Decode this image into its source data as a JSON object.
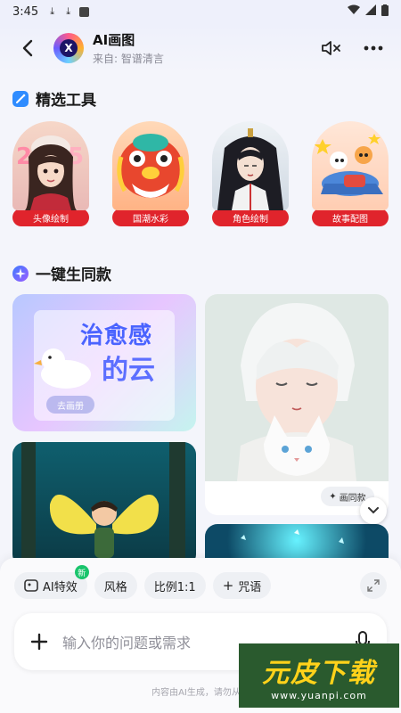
{
  "status_bar": {
    "time": "3:45"
  },
  "header": {
    "title": "AI画图",
    "subtitle": "来自: 智谱清言",
    "logo_letter": "X"
  },
  "tools_section": {
    "title": "精选工具",
    "items": [
      {
        "label": "头像绘制"
      },
      {
        "label": "国潮水彩"
      },
      {
        "label": "角色绘制"
      },
      {
        "label": "故事配图"
      }
    ]
  },
  "oneclick_section": {
    "title": "一键生同款",
    "card1": {
      "art_text_1": "治愈感",
      "art_text_2": "的云",
      "button": "去画册"
    },
    "card2": {
      "same_style_button": "画同款"
    }
  },
  "bottom": {
    "chips": [
      {
        "label": "AI特效",
        "badge": "新"
      },
      {
        "label": "风格"
      },
      {
        "label": "比例1:1"
      },
      {
        "label": "咒语"
      }
    ],
    "input_placeholder": "输入你的问题或需求",
    "disclaimer": "内容由AI生成，请勿从事"
  },
  "watermark": {
    "text": "元皮下载",
    "url": "www.yuanpi.com"
  },
  "colors": {
    "accent_red": "#e0242c",
    "badge_green": "#19c46c"
  }
}
